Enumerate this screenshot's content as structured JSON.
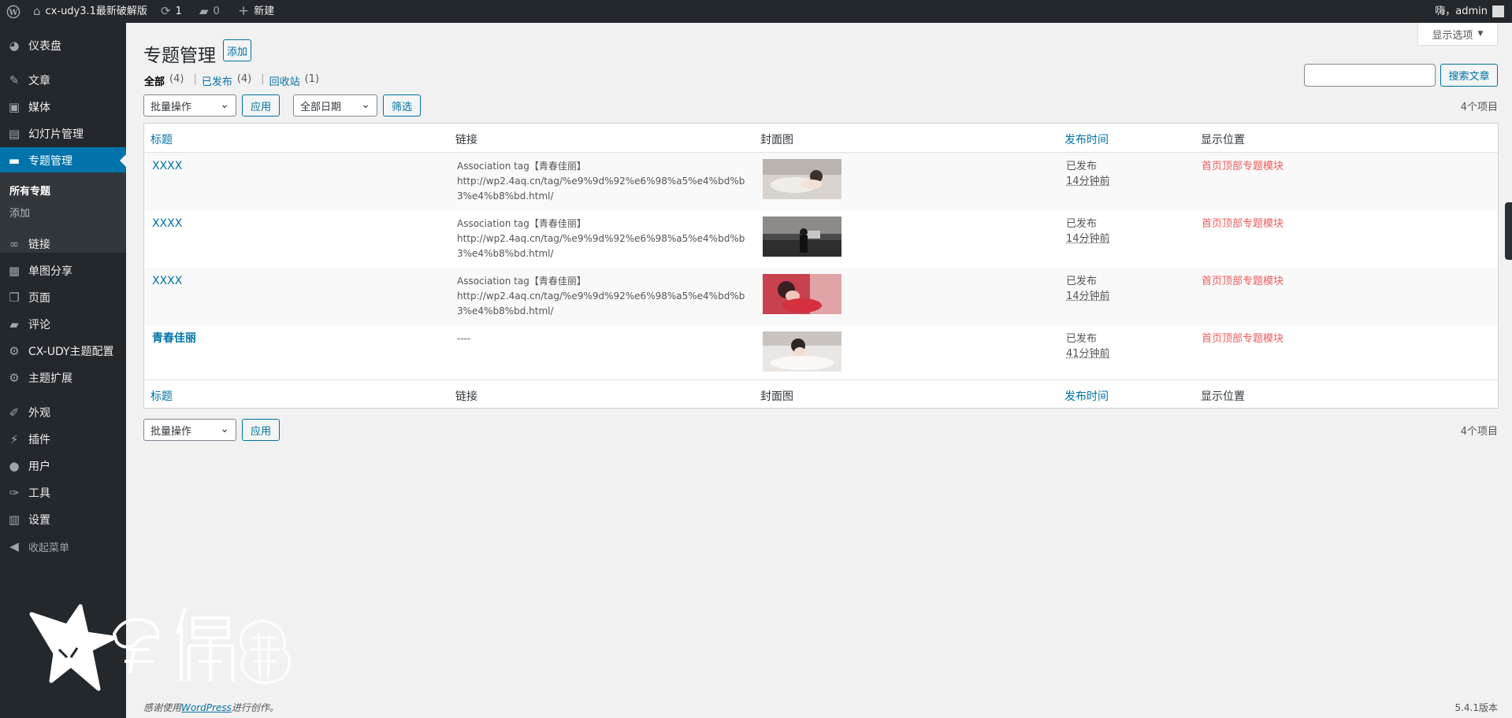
{
  "adminbar": {
    "site_name": "cx-udy3.1最新破解版",
    "updates_count": "1",
    "comments_count": "0",
    "new_label": "新建",
    "greeting": "嗨，admin"
  },
  "sidebar": {
    "items": [
      {
        "label": "仪表盘",
        "icon": "dashboard-icon"
      },
      {
        "label": "文章",
        "icon": "pin-icon"
      },
      {
        "label": "媒体",
        "icon": "media-icon"
      },
      {
        "label": "幻灯片管理",
        "icon": "slides-icon"
      },
      {
        "label": "专题管理",
        "icon": "folder-icon"
      },
      {
        "label": "链接",
        "icon": "link-icon"
      },
      {
        "label": "单图分享",
        "icon": "image-icon"
      },
      {
        "label": "页面",
        "icon": "page-icon"
      },
      {
        "label": "评论",
        "icon": "comment-icon"
      },
      {
        "label": "CX-UDY主题配置",
        "icon": "gear-icon"
      },
      {
        "label": "主题扩展",
        "icon": "gear-icon"
      },
      {
        "label": "外观",
        "icon": "brush-icon"
      },
      {
        "label": "插件",
        "icon": "plugin-icon"
      },
      {
        "label": "用户",
        "icon": "user-icon"
      },
      {
        "label": "工具",
        "icon": "wrench-icon"
      },
      {
        "label": "设置",
        "icon": "settings-icon"
      }
    ],
    "submenu": [
      "所有专题",
      "添加"
    ],
    "collapse_label": "收起菜单",
    "accent": "#0073aa"
  },
  "screen_options": "显示选项",
  "page": {
    "title": "专题管理",
    "add_button": "添加",
    "filters": {
      "all_label": "全部",
      "all_count": "(4)",
      "published_label": "已发布",
      "published_count": "(4)",
      "trash_label": "回收站",
      "trash_count": "(1)",
      "separator": "|"
    },
    "search_button": "搜索文章",
    "bulk_action": "批量操作",
    "apply": "应用",
    "date_filter": "全部日期",
    "filter_button": "筛选",
    "items_count": "4个项目"
  },
  "table": {
    "columns": [
      "标题",
      "链接",
      "封面图",
      "发布时间",
      "显示位置"
    ],
    "rows": [
      {
        "title": "XXXX",
        "link_label": "Association tag【青春佳丽】",
        "link_url": "http://wp2.4aq.cn/tag/%e9%9d%92%e6%98%a5%e4%bd%b3%e4%b8%bd.html/",
        "status": "已发布",
        "ago": "14分钟前",
        "position": "首页顶部专题模块"
      },
      {
        "title": "XXXX",
        "link_label": "Association tag【青春佳丽】",
        "link_url": "http://wp2.4aq.cn/tag/%e9%9d%92%e6%98%a5%e4%bd%b3%e4%b8%bd.html/",
        "status": "已发布",
        "ago": "14分钟前",
        "position": "首页顶部专题模块"
      },
      {
        "title": "XXXX",
        "link_label": "Association tag【青春佳丽】",
        "link_url": "http://wp2.4aq.cn/tag/%e9%9d%92%e6%98%a5%e4%bd%b3%e4%b8%bd.html/",
        "status": "已发布",
        "ago": "14分钟前",
        "position": "首页顶部专题模块"
      },
      {
        "title": "青春佳丽",
        "link_label": "----",
        "link_url": "",
        "status": "已发布",
        "ago": "41分钟前",
        "position": "首页顶部专题模块"
      }
    ]
  },
  "footer": {
    "thanks_prefix": "感谢使用",
    "wordpress": "WordPress",
    "thanks_suffix": "进行创作。",
    "version": "5.4.1版本"
  },
  "watermark_text": "偶猫"
}
